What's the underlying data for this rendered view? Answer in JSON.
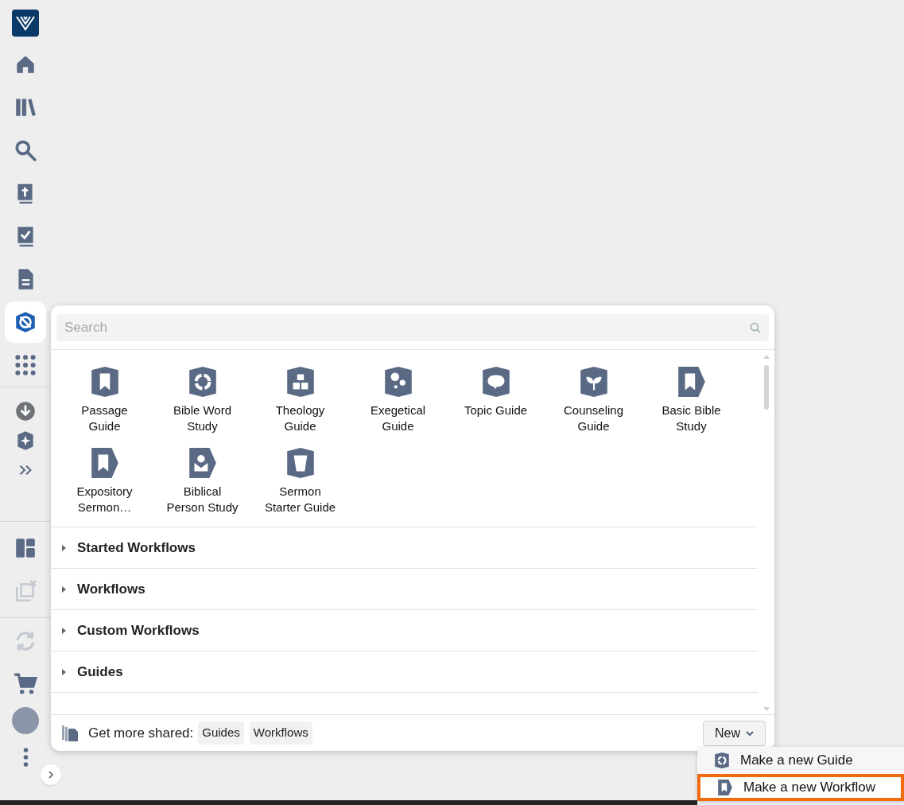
{
  "sidebar": {
    "items": [
      {
        "selected": false,
        "disabled": false
      },
      {
        "selected": false,
        "disabled": false
      },
      {
        "selected": false,
        "disabled": false
      },
      {
        "selected": false,
        "disabled": false
      },
      {
        "selected": false,
        "disabled": false
      },
      {
        "selected": false,
        "disabled": false
      },
      {
        "selected": true,
        "disabled": false
      },
      {
        "selected": false,
        "disabled": false
      },
      {
        "selected": false,
        "disabled": false
      },
      {
        "selected": false,
        "disabled": false
      },
      {
        "selected": false,
        "disabled": false
      },
      {
        "selected": false,
        "disabled": false
      },
      {
        "selected": false,
        "disabled": true
      },
      {
        "selected": false,
        "disabled": true
      },
      {
        "selected": false,
        "disabled": false
      },
      {
        "selected": false,
        "disabled": false
      }
    ]
  },
  "panel": {
    "search": {
      "placeholder": "Search"
    },
    "tiles": [
      {
        "kind": "guide",
        "label": "Passage Guide"
      },
      {
        "kind": "guide",
        "label": "Bible Word Study"
      },
      {
        "kind": "guide",
        "label": "Theology Guide"
      },
      {
        "kind": "guide",
        "label": "Exegetical Guide"
      },
      {
        "kind": "guide",
        "label": "Topic Guide"
      },
      {
        "kind": "guide",
        "label": "Counseling Guide"
      },
      {
        "kind": "workflow",
        "label": "Basic Bible Study"
      },
      {
        "kind": "workflow",
        "label": "Expository Sermon…"
      },
      {
        "kind": "workflow",
        "label": "Biblical Person Study"
      },
      {
        "kind": "guide",
        "label": "Sermon Starter Guide"
      }
    ],
    "sections": [
      {
        "label": "Started Workflows",
        "expanded": false
      },
      {
        "label": "Workflows",
        "expanded": false
      },
      {
        "label": "Custom Workflows",
        "expanded": false
      },
      {
        "label": "Guides",
        "expanded": false
      }
    ],
    "footer": {
      "label": "Get more shared:",
      "links": [
        "Guides",
        "Workflows"
      ],
      "new_button": "New"
    }
  },
  "menu": {
    "items": [
      {
        "kind": "guide",
        "label": "Make a new Guide",
        "selected": false
      },
      {
        "kind": "workflow",
        "label": "Make a new Workflow",
        "selected": true
      }
    ]
  }
}
